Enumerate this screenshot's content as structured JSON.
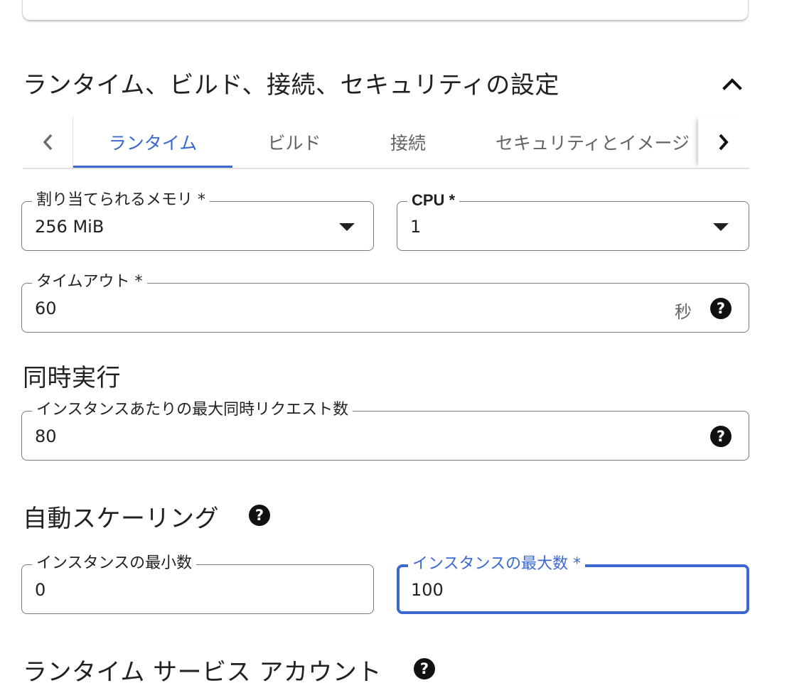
{
  "section": {
    "title": "ランタイム、ビルド、接続、セキュリティの設定"
  },
  "tabs": [
    {
      "label": "ランタイム",
      "active": true
    },
    {
      "label": "ビルド",
      "active": false
    },
    {
      "label": "接続",
      "active": false
    },
    {
      "label": "セキュリティとイメージ",
      "active": false
    }
  ],
  "fields": {
    "memory": {
      "label": "割り当てられるメモリ *",
      "value": "256 MiB"
    },
    "cpu": {
      "label": "CPU *",
      "value": "1"
    },
    "timeout": {
      "label": "タイムアウト *",
      "value": "60",
      "suffix": "秒"
    },
    "concurrency": {
      "label": "インスタンスあたりの最大同時リクエスト数",
      "value": "80"
    },
    "min_instances": {
      "label": "インスタンスの最小数",
      "value": "0"
    },
    "max_instances": {
      "label": "インスタンスの最大数 *",
      "value": "100"
    }
  },
  "headings": {
    "concurrency": "同時実行",
    "autoscaling": "自動スケーリング",
    "service_account": "ランタイム サービス アカウント"
  },
  "icons": {
    "help": "?",
    "collapse": "chevron-up-icon",
    "tab_prev": "chevron-left-icon",
    "tab_next": "chevron-right-icon"
  },
  "colors": {
    "accent": "#3b68d1",
    "text": "#202124",
    "muted": "#5f6368",
    "border": "#7a7a7a"
  }
}
